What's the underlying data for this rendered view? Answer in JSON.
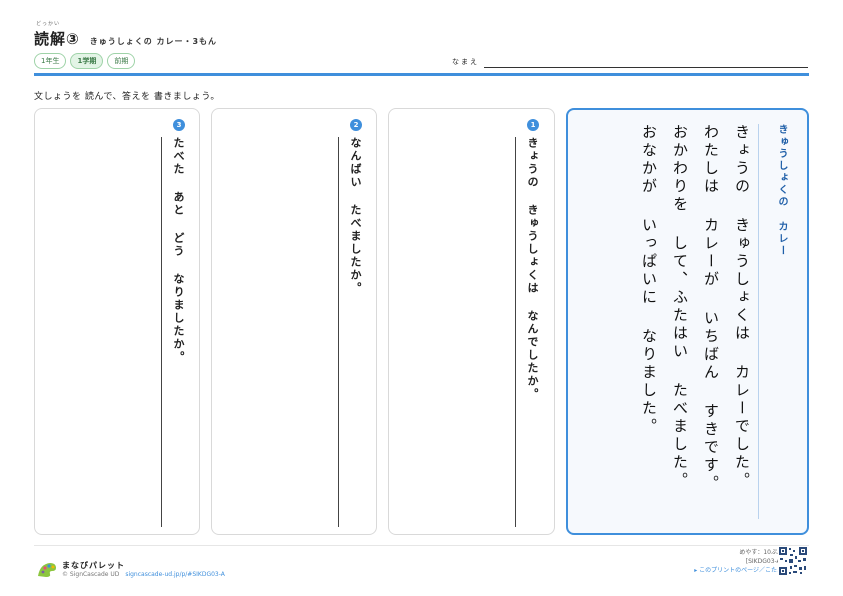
{
  "header": {
    "ruby": "どっかい",
    "title": "読解③",
    "subtitle": "きゅうしょくの カレー・3もん",
    "badges": [
      "1年生",
      "1学期",
      "前期"
    ],
    "name_label": "なまえ"
  },
  "instruction": "文しょうを 読んで、答えを 書きましょう。",
  "questions": [
    {
      "number": "1",
      "text": "きょうの きゅうしょくは なんでしたか。"
    },
    {
      "number": "2",
      "text": "なんばい たべましたか。"
    },
    {
      "number": "3",
      "text": "たべた あと どう なりましたか。"
    }
  ],
  "story": {
    "title": "きゅうしょくの カレー",
    "body": "きょうの きゅうしょくは カレーでした。\nわたしは カレーが いちばん すきです。\nおかわりを して、ふたはい たべました。\nおなかが いっぱいに なりました。"
  },
  "footer": {
    "brand": "まなびパレット",
    "copyright": "© SignCascade UD",
    "url": "signcascade-ud.jp/p/#SIKDG03-A",
    "time": "めやす：10ぷん",
    "code": "[SIKDG03-A]",
    "answer_link": "▸ このプリントのページ／こたえ"
  },
  "colors": {
    "accent": "#3f8fdc",
    "badge_green": "#3b7a47"
  }
}
